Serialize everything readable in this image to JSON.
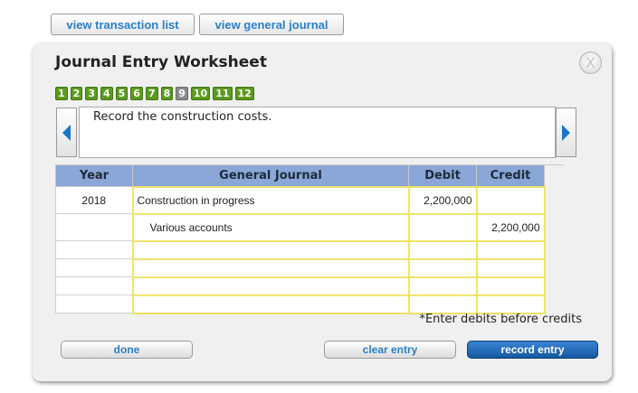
{
  "toolbar": {
    "view_transaction_list": "view transaction list",
    "view_general_journal": "view general journal"
  },
  "worksheet": {
    "title": "Journal Entry Worksheet",
    "close_label": "X",
    "steps": [
      "1",
      "2",
      "3",
      "4",
      "5",
      "6",
      "7",
      "8",
      "9",
      "10",
      "11",
      "12"
    ],
    "active_step": "9",
    "instruction": "Record the construction costs.",
    "columns": {
      "year": "Year",
      "general_journal": "General Journal",
      "debit": "Debit",
      "credit": "Credit"
    },
    "rows": [
      {
        "year": "2018",
        "account": "Construction in progress",
        "debit": "2,200,000",
        "credit": ""
      },
      {
        "year": "",
        "account": "Various accounts",
        "debit": "",
        "credit": "2,200,000"
      },
      {
        "year": "",
        "account": "",
        "debit": "",
        "credit": ""
      },
      {
        "year": "",
        "account": "",
        "debit": "",
        "credit": ""
      },
      {
        "year": "",
        "account": "",
        "debit": "",
        "credit": ""
      },
      {
        "year": "",
        "account": "",
        "debit": "",
        "credit": ""
      }
    ],
    "note": "*Enter debits before credits",
    "buttons": {
      "done": "done",
      "clear": "clear entry",
      "record": "record entry"
    }
  },
  "colors": {
    "step_green": "#5c9a1e",
    "step_active": "#8c8c8c",
    "header_blue": "#8aa7d7",
    "accent_blue": "#1a76c9"
  },
  "icons": {
    "prev": "arrow-left-icon",
    "next": "arrow-right-icon",
    "close": "close-icon"
  }
}
